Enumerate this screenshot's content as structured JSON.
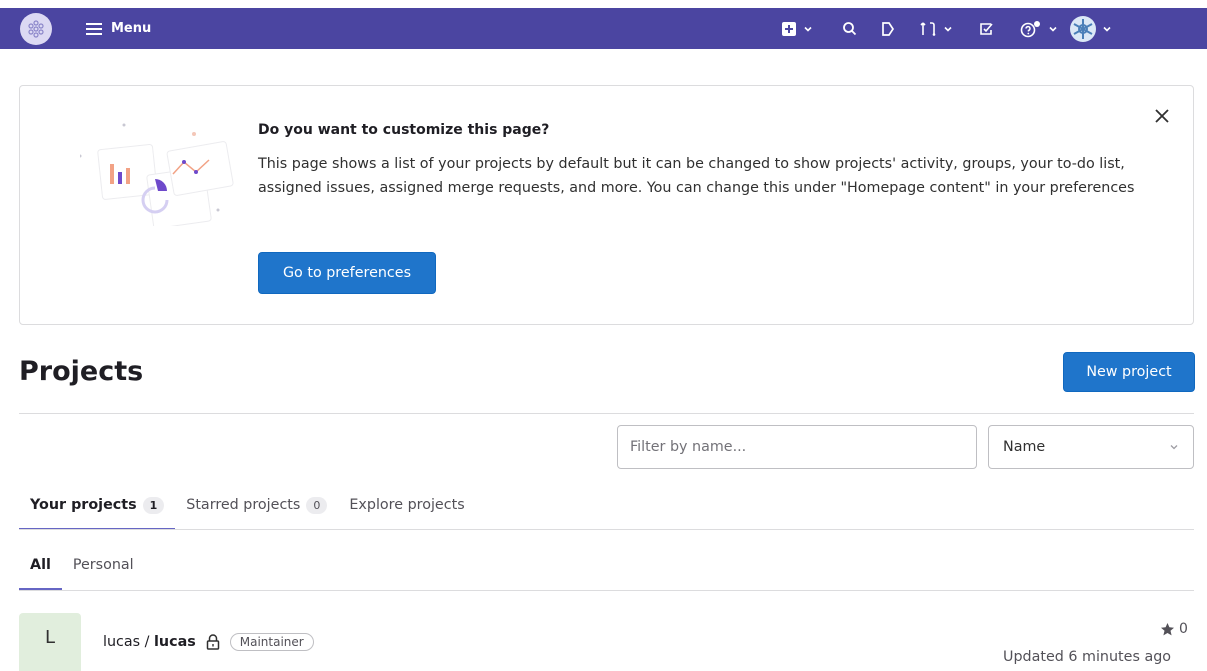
{
  "navbar": {
    "menu_label": "Menu",
    "colors": {
      "bar": "#4b45a1"
    },
    "icons": [
      "logo-icon",
      "plus-square-icon",
      "search-icon",
      "issues-icon",
      "merge-request-icon",
      "todo-icon",
      "help-icon",
      "avatar-icon"
    ]
  },
  "banner": {
    "title": "Do you want to customize this page?",
    "body": "This page shows a list of your projects by default but it can be changed to show projects' activity, groups, your to-do list, assigned issues, assigned merge requests, and more. You can change this under \"Homepage content\" in your preferences",
    "button_label": "Go to preferences"
  },
  "page": {
    "title": "Projects",
    "new_project_label": "New project"
  },
  "filter": {
    "placeholder": "Filter by name...",
    "sort_value": "Name"
  },
  "tabs": [
    {
      "label": "Your projects",
      "count": "1"
    },
    {
      "label": "Starred projects",
      "count": "0"
    },
    {
      "label": "Explore projects"
    }
  ],
  "subtabs": [
    {
      "label": "All"
    },
    {
      "label": "Personal"
    }
  ],
  "projects": [
    {
      "avatar_letter": "L",
      "namespace": "lucas",
      "separator": " / ",
      "name": "lucas",
      "role": "Maintainer",
      "stars": "0",
      "updated": "Updated 6 minutes ago"
    }
  ]
}
